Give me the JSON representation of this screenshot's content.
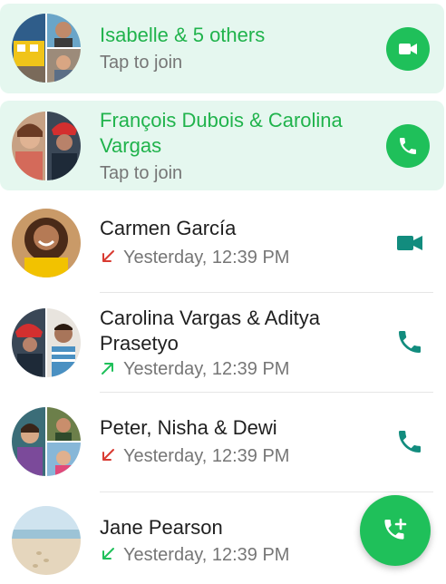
{
  "colors": {
    "accent": "#1fc05a",
    "accent_text": "#20b34c",
    "active_row_bg": "#e5f7ef",
    "icon_teal": "#128c7e",
    "missed_red": "#d93b32",
    "outgoing_green": "#1fc05a"
  },
  "calls": [
    {
      "name": "Isabelle & 5 others",
      "subtitle": "Tap to join",
      "active": true,
      "action_icon": "video-icon"
    },
    {
      "name": "François Dubois & Carolina Vargas",
      "subtitle": "Tap to join",
      "active": true,
      "action_icon": "phone-icon"
    },
    {
      "name": "Carmen García",
      "subtitle": "Yesterday, 12:39 PM",
      "direction": "missed",
      "direction_icon": "missed-call-arrow-icon",
      "action_icon": "video-icon"
    },
    {
      "name": "Carolina Vargas & Aditya Prasetyo",
      "subtitle": "Yesterday, 12:39 PM",
      "direction": "outgoing",
      "direction_icon": "outgoing-call-arrow-icon",
      "action_icon": "phone-icon"
    },
    {
      "name": "Peter, Nisha & Dewi",
      "subtitle": "Yesterday, 12:39 PM",
      "direction": "missed",
      "direction_icon": "missed-call-arrow-icon",
      "action_icon": "phone-icon"
    },
    {
      "name": "Jane Pearson",
      "subtitle": "Yesterday, 12:39 PM",
      "direction": "incoming",
      "direction_icon": "incoming-call-arrow-icon",
      "action_icon": "phone-icon"
    }
  ],
  "fab": {
    "icon": "add-call-icon"
  }
}
